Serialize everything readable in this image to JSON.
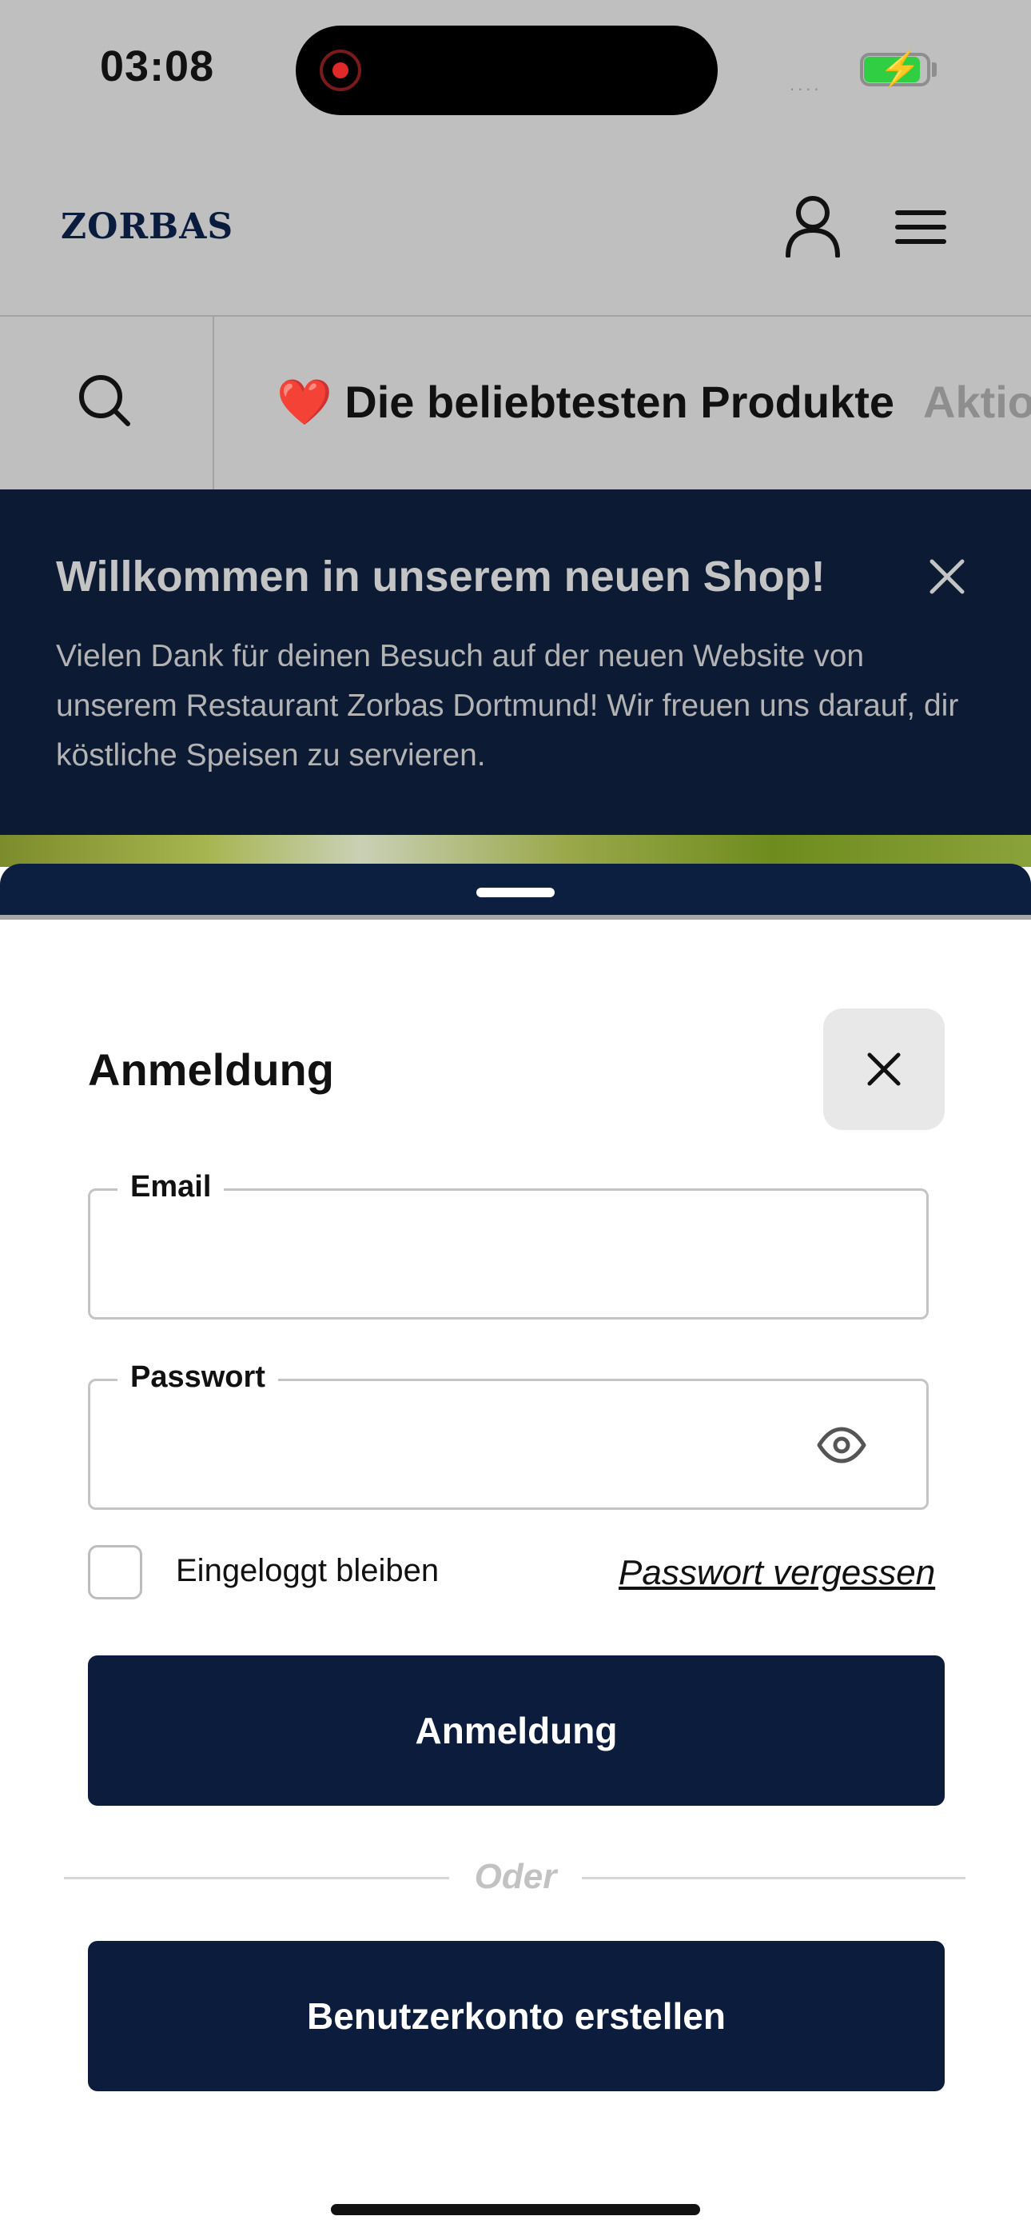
{
  "status_bar": {
    "time": "03:08",
    "signal": "....",
    "battery_color": "#2fce43"
  },
  "header": {
    "logo": "ZORBAS",
    "icons": [
      "user-icon",
      "menu-icon"
    ]
  },
  "nav": {
    "search_icon": "search-icon",
    "items": [
      {
        "label": "❤️ Die beliebtesten Produkte"
      },
      {
        "label": "Aktio"
      }
    ]
  },
  "banner": {
    "title": "Willkommen in unserem neuen Shop!",
    "text": "Vielen Dank für deinen Besuch auf der neuen Website von unserem Restaurant Zorbas Dortmund! Wir freuen uns darauf, dir köstliche Speisen zu servieren.",
    "background": "#0c1a33"
  },
  "login": {
    "title": "Anmeldung",
    "email_label": "Email",
    "email_value": "",
    "password_label": "Passwort",
    "password_value": "",
    "remember_label": "Eingeloggt bleiben",
    "remember_checked": false,
    "forgot_label": "Passwort vergessen",
    "login_button": "Anmeldung",
    "or_label": "Oder",
    "register_button": "Benutzerkonto erstellen",
    "button_color": "#0c1c3d"
  }
}
